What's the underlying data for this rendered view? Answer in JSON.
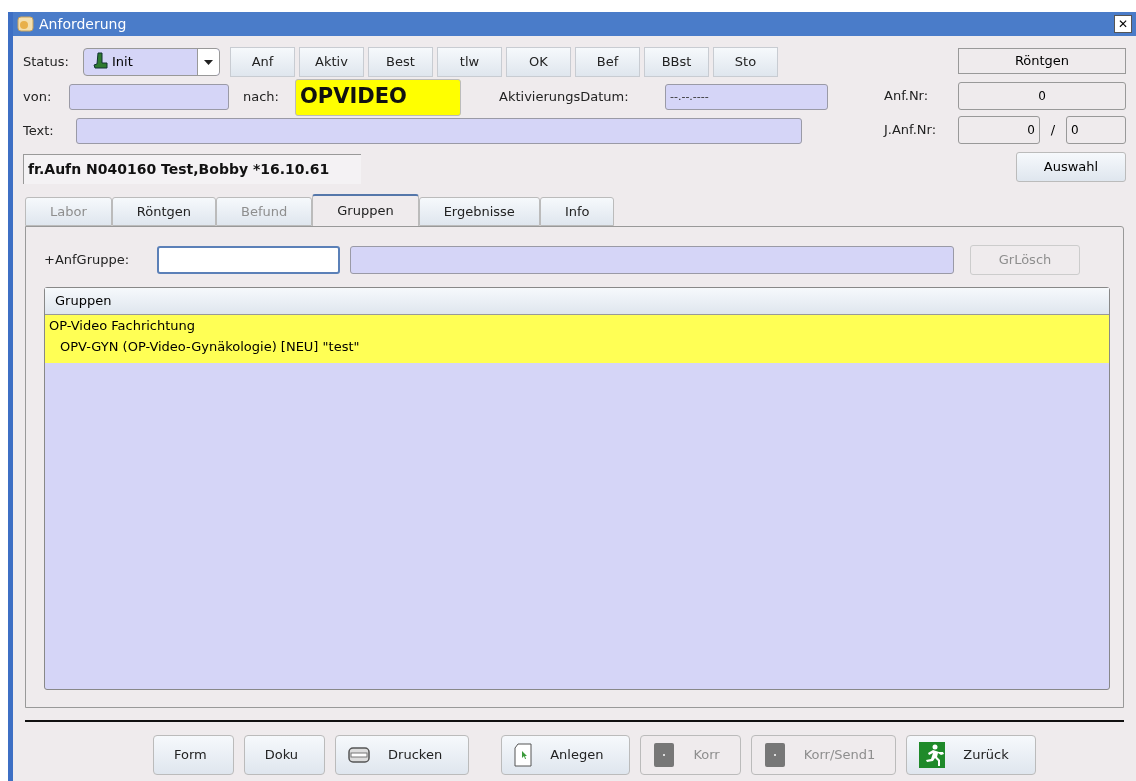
{
  "window": {
    "title": "Anforderung",
    "close": "✕"
  },
  "status": {
    "label": "Status:",
    "value": "Init"
  },
  "status_buttons": [
    "Anf",
    "Aktiv",
    "Best",
    "tlw",
    "OK",
    "Bef",
    "BBst",
    "Sto"
  ],
  "department": "Röntgen",
  "von": {
    "label": "von:"
  },
  "nach": {
    "label": "nach:",
    "value": "OPVIDEO"
  },
  "activation_date": {
    "label": "AktivierungsDatum:",
    "value": "--.--.----"
  },
  "anf_nr": {
    "label": "Anf.Nr:",
    "value": "0"
  },
  "text": {
    "label": "Text:"
  },
  "j_anf_nr": {
    "label": "J.Anf.Nr:",
    "value": "0",
    "separator": "/",
    "value_2": "0"
  },
  "patient": "fr.Aufn N040160 Test,Bobby *16.10.61",
  "auswahl": "Auswahl",
  "tabs": [
    {
      "label": "Labor",
      "selected": false,
      "disabled": true
    },
    {
      "label": "Röntgen",
      "selected": false,
      "disabled": false
    },
    {
      "label": "Befund",
      "selected": false,
      "disabled": true
    },
    {
      "label": "Gruppen",
      "selected": true,
      "disabled": false
    },
    {
      "label": "Ergebnisse",
      "selected": false,
      "disabled": false
    },
    {
      "label": "Info",
      "selected": false,
      "disabled": false
    }
  ],
  "group_input": {
    "label": "+AnfGruppe:",
    "delete_button": "GrLösch",
    "delete_disabled": true
  },
  "table": {
    "column": "Gruppen",
    "rows": [
      {
        "label": "OP-Video Fachrichtung",
        "selected": true,
        "children": [
          {
            "label": "OPV-GYN (OP-Video-Gynäkologie) [NEU] \"test\"",
            "selected": true
          }
        ]
      }
    ]
  },
  "buttons": [
    {
      "label": "Form",
      "kind": "plain",
      "disabled": false
    },
    {
      "label": "Doku",
      "kind": "plain",
      "disabled": false
    },
    {
      "label": "Drucken",
      "kind": "print",
      "disabled": false
    },
    {
      "label": "Anlegen",
      "kind": "create",
      "disabled": false
    },
    {
      "label": "Korr",
      "kind": "correct",
      "disabled": true
    },
    {
      "label": "Korr/Send1",
      "kind": "correct",
      "disabled": true
    },
    {
      "label": "Zurück",
      "kind": "back",
      "disabled": false
    }
  ]
}
